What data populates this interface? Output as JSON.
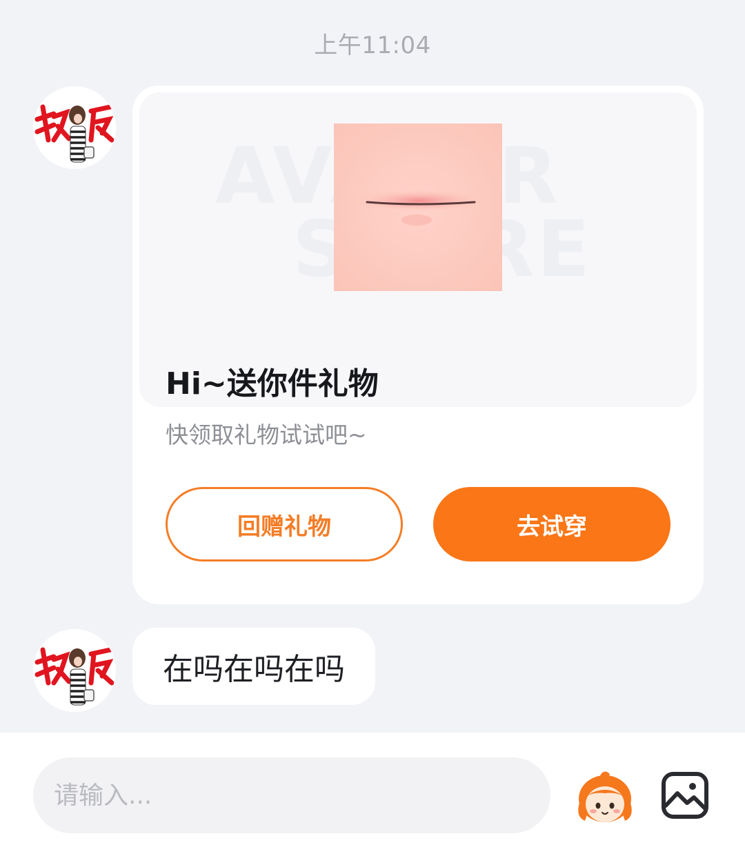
{
  "chat": {
    "timestamp": "上午11:04",
    "gift_card": {
      "watermark_line1": "AVATAR",
      "watermark_line2": "STORE",
      "title": "Hi~送你件礼物",
      "subtitle": "快领取礼物试试吧~",
      "return_gift_label": "回赠礼物",
      "try_on_label": "去试穿"
    },
    "message": {
      "text": "在吗在吗在吗"
    }
  },
  "composer": {
    "placeholder": "请输入..."
  },
  "colors": {
    "accent": "#fa7617",
    "background": "#f2f3f7",
    "avatar_text_red": "#e0151f"
  },
  "icons": {
    "emoji": "mascot-emoji-icon",
    "image": "image-picker-icon"
  }
}
